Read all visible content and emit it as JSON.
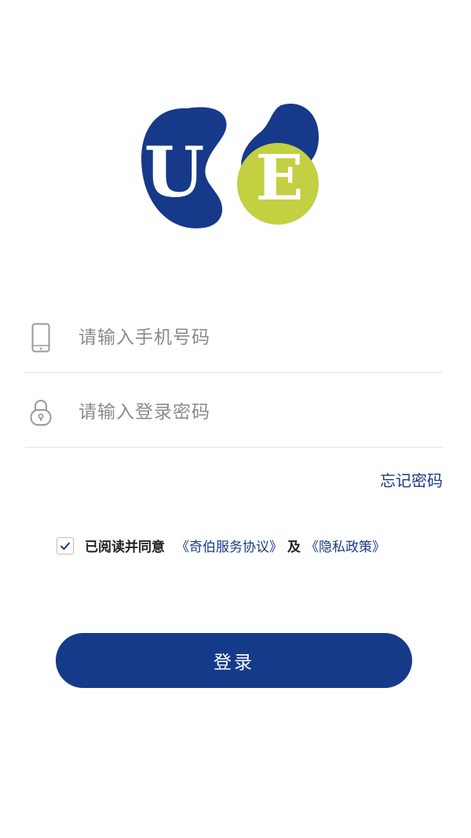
{
  "logo": {
    "letter_left": "U",
    "letter_right": "E",
    "colors": {
      "blue": "#16398a",
      "green": "#c2d042"
    }
  },
  "phone_field": {
    "icon": "phone-icon",
    "value": "",
    "placeholder": "请输入手机号码"
  },
  "password_field": {
    "icon": "lock-icon",
    "value": "",
    "placeholder": "请输入登录密码"
  },
  "forgot_password": "忘记密码",
  "agreement": {
    "checked": true,
    "prefix": "已阅读并同意",
    "terms_link": "《奇伯服务协议》",
    "conjunction": "及",
    "privacy_link": "《隐私政策》"
  },
  "login_button": "登录",
  "colors": {
    "primary": "#163a8a",
    "link": "#1b3a86",
    "placeholder": "#8a8a8a",
    "divider": "#e3e3e3"
  }
}
